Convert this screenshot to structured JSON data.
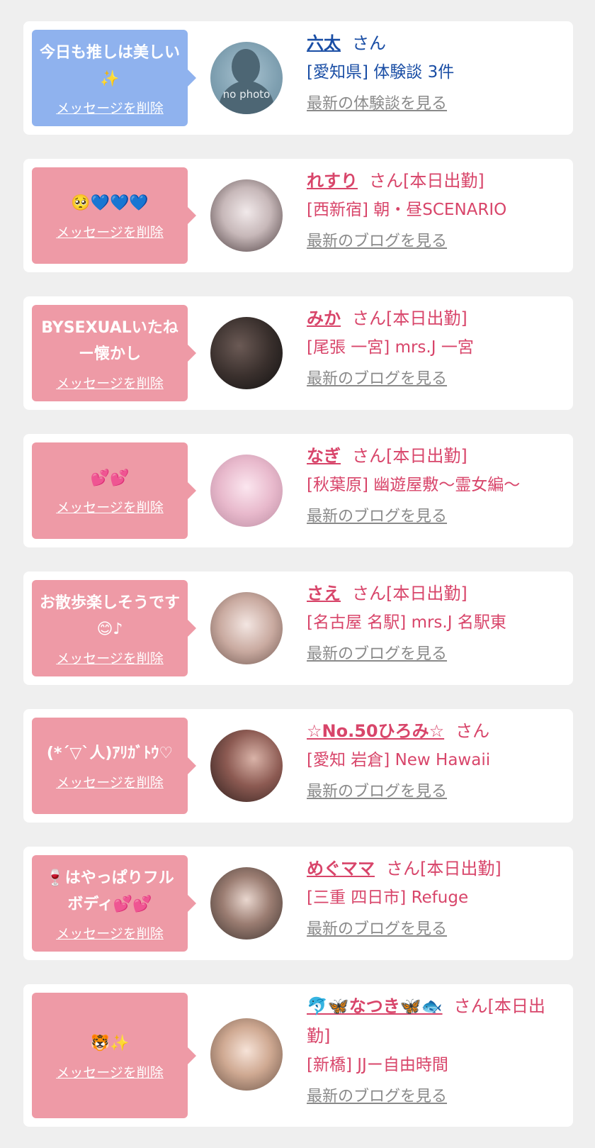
{
  "colors": {
    "bubble_blue": "#8fb2ee",
    "bubble_pink": "#ee9aa6",
    "name_blue": "#1a4ea5",
    "name_pink": "#d8456a",
    "link_gray": "#8a8a8a",
    "card_bg": "#ffffff",
    "page_bg": "#efefef"
  },
  "delete_label": "メッセージを削除",
  "cards": [
    {
      "message": "今日も推しは美しい✨",
      "name": "六太",
      "suffix": "さん",
      "shop": "[愛知県] 体験談 3件",
      "latest_link": "最新の体験談を見る",
      "avatar": "no photo"
    },
    {
      "message": "🥺💙💙💙",
      "name": "れすり",
      "suffix": "さん[本日出勤]",
      "shop": "[西新宿] 朝・昼SCENARIO",
      "latest_link": "最新のブログを見る"
    },
    {
      "message": "BYSEXUALいたねー懐かし",
      "name": "みか",
      "suffix": "さん[本日出勤]",
      "shop": "[尾張 一宮] mrs.J 一宮",
      "latest_link": "最新のブログを見る"
    },
    {
      "message": "💕💕",
      "name": "なぎ",
      "suffix": "さん[本日出勤]",
      "shop": "[秋葉原] 幽遊屋敷〜霊女編〜",
      "latest_link": "最新のブログを見る"
    },
    {
      "message": "お散歩楽しそうです😊♪",
      "name": "さえ",
      "suffix": "さん[本日出勤]",
      "shop": "[名古屋 名駅] mrs.J 名駅東",
      "latest_link": "最新のブログを見る"
    },
    {
      "message": "(*´▽`人)ｱﾘｶﾞﾄｳ♡",
      "name": "☆No.50ひろみ☆",
      "suffix": "さん",
      "shop": "[愛知 岩倉] New Hawaii",
      "latest_link": "最新のブログを見る"
    },
    {
      "message": "🍷はやっぱりフルボディ💕💕",
      "name": "めぐママ",
      "suffix": "さん[本日出勤]",
      "shop": "[三重 四日市] Refuge",
      "latest_link": "最新のブログを見る"
    },
    {
      "message": "🐯✨",
      "name": "🐬🦋なつき🦋🐟",
      "suffix": "さん[本日出勤]",
      "shop": "[新橋] JJー自由時間",
      "latest_link": "最新のブログを見る"
    }
  ]
}
